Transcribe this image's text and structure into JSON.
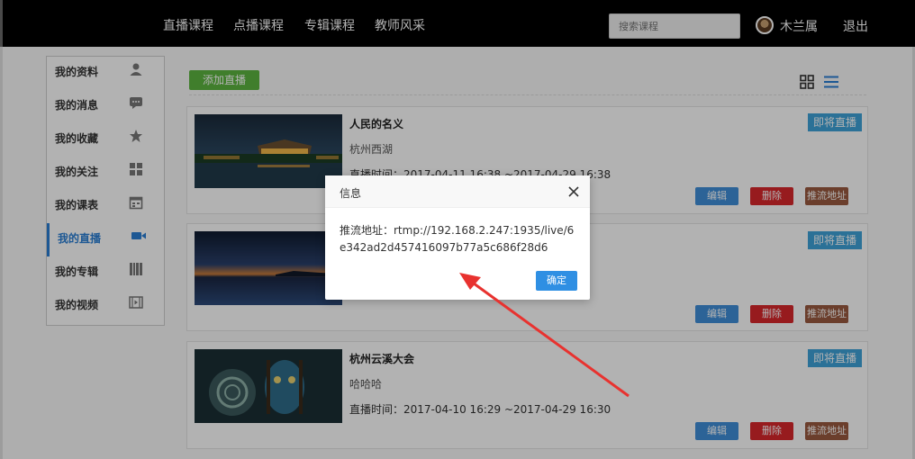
{
  "nav": {
    "items": [
      "直播课程",
      "点播课程",
      "专辑课程",
      "教师风采"
    ],
    "search_placeholder": "搜索课程",
    "username": "木兰属",
    "logout": "退出"
  },
  "sidebar": {
    "items": [
      {
        "label": "我的资料",
        "icon": "user-icon"
      },
      {
        "label": "我的消息",
        "icon": "message-icon"
      },
      {
        "label": "我的收藏",
        "icon": "star-icon"
      },
      {
        "label": "我的关注",
        "icon": "grid-icon"
      },
      {
        "label": "我的课表",
        "icon": "calendar-icon"
      },
      {
        "label": "我的直播",
        "icon": "video-camera-icon",
        "active": true
      },
      {
        "label": "我的专辑",
        "icon": "books-icon"
      },
      {
        "label": "我的视频",
        "icon": "film-icon"
      }
    ]
  },
  "toolbar": {
    "add_label": "添加直播",
    "view_grid_icon": "grid-view-icon",
    "view_list_icon": "list-view-icon"
  },
  "cards": [
    {
      "title": "人民的名义",
      "location": "杭州西湖",
      "time": "直播时间：2017-04-11 16:38 ~2017-04-29 16:38",
      "status": "即将直播",
      "edit": "编辑",
      "delete": "删除",
      "push": "推流地址"
    },
    {
      "title": "",
      "location": "",
      "time": "",
      "status": "即将直播",
      "edit": "编辑",
      "delete": "删除",
      "push": "推流地址"
    },
    {
      "title": "杭州云溪大会",
      "location": "哈哈哈",
      "time": "直播时间：2017-04-10 16:29 ~2017-04-29 16:30",
      "status": "即将直播",
      "edit": "编辑",
      "delete": "删除",
      "push": "推流地址"
    }
  ],
  "dialog": {
    "title": "信息",
    "message": "推流地址：rtmp://192.168.2.247:1935/live/6e342ad2d457416097b77a5c686f28d6",
    "ok": "确定"
  },
  "colors": {
    "topbar": "#000000",
    "accent": "#2a7fd4",
    "add_green": "#5cb53f",
    "badge_blue": "#3ea2d8",
    "delete_red": "#d9272c",
    "push_brown": "#9a5a3f",
    "arrow_red": "#e8322f"
  }
}
